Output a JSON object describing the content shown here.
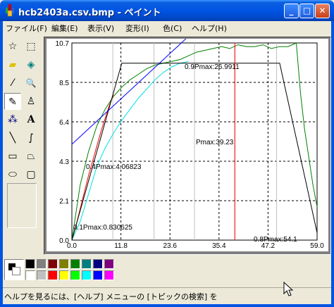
{
  "window": {
    "title": "hcb2403a.csv.bmp - ペイント",
    "minimize_glyph": "_",
    "maximize_glyph": "□",
    "close_glyph": "✕"
  },
  "menu": [
    "ファイル(F)",
    "編集(E)",
    "表示(V)",
    "変形(I)",
    "色(C)",
    "ヘルプ(H)"
  ],
  "tools": [
    {
      "name": "free-select-icon",
      "glyph": "☆"
    },
    {
      "name": "rect-select-icon",
      "glyph": "⬚"
    },
    {
      "name": "eraser-icon",
      "glyph": "▰"
    },
    {
      "name": "fill-bucket-icon",
      "glyph": "◈"
    },
    {
      "name": "eyedropper-icon",
      "glyph": "⁄"
    },
    {
      "name": "magnifier-icon",
      "glyph": "🔍"
    },
    {
      "name": "pencil-icon",
      "glyph": "✎"
    },
    {
      "name": "brush-icon",
      "glyph": "♙"
    },
    {
      "name": "airbrush-icon",
      "glyph": "⁂"
    },
    {
      "name": "text-icon",
      "glyph": "A"
    },
    {
      "name": "line-icon",
      "glyph": "╲"
    },
    {
      "name": "curve-icon",
      "glyph": "∫"
    },
    {
      "name": "rectangle-icon",
      "glyph": "▭"
    },
    {
      "name": "polygon-icon",
      "glyph": "⏢"
    },
    {
      "name": "ellipse-icon",
      "glyph": "⬭"
    },
    {
      "name": "rounded-rect-icon",
      "glyph": "▢"
    }
  ],
  "palette": {
    "top": [
      "#000000",
      "#808080",
      "#800000",
      "#808000",
      "#008000",
      "#008080",
      "#000080",
      "#800080"
    ],
    "bottom": [
      "#FFFFFF",
      "#C0C0C0",
      "#FF0000",
      "#FFFF00",
      "#00FF00",
      "#00FFFF",
      "#0000FF",
      "#FF00FF"
    ]
  },
  "status": "ヘルプを見るには、[ヘルプ] メニューの [トピックの検索] を",
  "chart_data": {
    "type": "line",
    "y_ticks": [
      "10.7",
      "8.5",
      "6.4",
      "4.3",
      "2.1",
      "0.0"
    ],
    "x_ticks": [
      "0.0",
      "11.8",
      "23.6",
      "35.4",
      "47.2",
      "59.0"
    ],
    "xlim": [
      0,
      59
    ],
    "ylim": [
      0,
      10.7
    ],
    "grid": true,
    "annotations": [
      "0.9Pmax:26.9911",
      "Pmax:39.23",
      "0.4Pmax:4.06823",
      "0.1Pmax:0.830625",
      "0.8Pmax:54.1"
    ],
    "series": [
      {
        "color": "#008000",
        "x": [
          0,
          1,
          2,
          4,
          6,
          8,
          10,
          12,
          14,
          16,
          18,
          20,
          22,
          24,
          26,
          28,
          30,
          32,
          34,
          36,
          38,
          40,
          42,
          44,
          46,
          48,
          50,
          52,
          54,
          55,
          56,
          57,
          58,
          59
        ],
        "values": [
          0,
          1.5,
          3.0,
          4.8,
          6.2,
          7.1,
          7.8,
          8.3,
          8.7,
          9.0,
          9.3,
          9.5,
          9.6,
          9.7,
          9.8,
          10.0,
          10.2,
          10.3,
          10.4,
          10.5,
          10.4,
          10.6,
          10.5,
          10.5,
          10.6,
          10.4,
          10.5,
          10.5,
          10.7,
          8.0,
          6.0,
          4.5,
          3.0,
          1.8
        ]
      },
      {
        "color": "#00E0E0",
        "x": [
          0,
          2,
          4,
          6,
          8,
          10,
          12,
          14,
          16,
          18,
          20,
          22,
          24,
          26,
          28
        ],
        "values": [
          0,
          1.0,
          2.5,
          4.0,
          5.0,
          5.8,
          6.5,
          7.1,
          7.7,
          8.2,
          8.7,
          9.1,
          9.4,
          9.6,
          9.7
        ]
      },
      {
        "color": "#FF0000",
        "x": [
          0,
          1,
          2,
          3,
          4,
          5,
          6,
          7,
          8,
          9,
          10
        ],
        "values": [
          0,
          0.8,
          1.7,
          2.6,
          3.5,
          4.3,
          5.1,
          5.9,
          6.6,
          7.3,
          7.9
        ]
      },
      {
        "color": "#000000",
        "x": [
          0,
          12,
          50,
          59
        ],
        "values": [
          0,
          9.6,
          9.6,
          0.4
        ]
      },
      {
        "color": "#0000FF",
        "x": [
          0,
          30
        ],
        "values": [
          5.2,
          11.8
        ]
      }
    ]
  }
}
